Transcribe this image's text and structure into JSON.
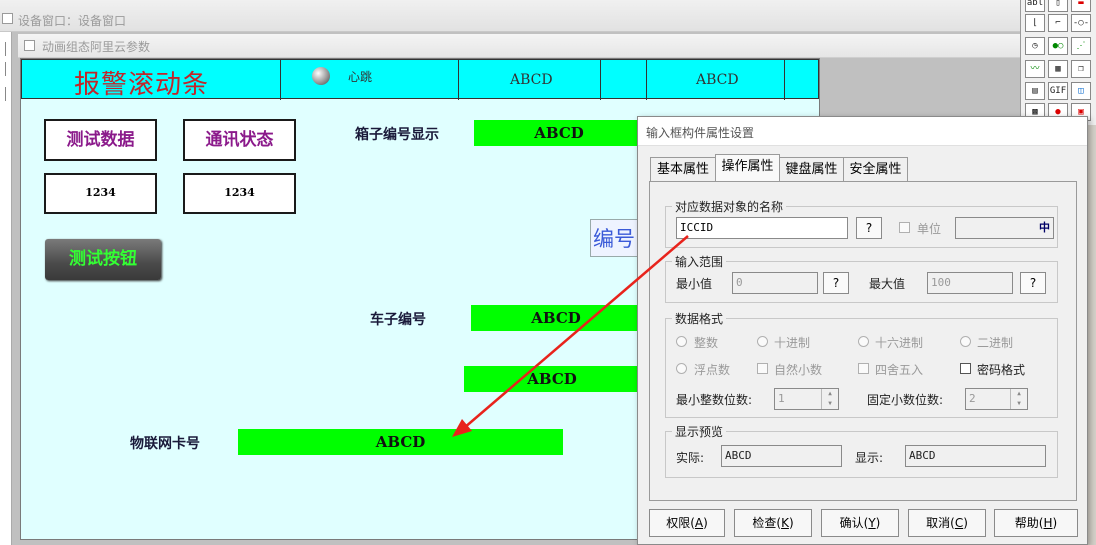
{
  "outer_window": {
    "title": "设备窗口：设备窗口"
  },
  "inner_window": {
    "title": "动画组态阿里云参数"
  },
  "header_bar": {
    "alarm_scroll_text": "报警滚动条",
    "heartbeat_label": "心跳",
    "cell1": "ABCD",
    "cell2": "ABCD"
  },
  "canvas": {
    "test_data_label": "测试数据",
    "comm_status_label": "通讯状态",
    "test_data_value": "1234",
    "comm_status_value": "1234",
    "test_button_label": "测试按钮",
    "box_id_label": "箱子编号显示",
    "box_id_value": "ABCD",
    "bianhao_text": "编号",
    "car_id_label": "车子编号",
    "car_id_value": "ABCD",
    "extra_value": "ABCD",
    "iot_card_label": "物联网卡号",
    "iot_card_value": "ABCD"
  },
  "toolbox": {
    "icons": [
      "text-tool-icon",
      "input-box-icon",
      "flag-icon",
      "line-icon",
      "step-line-icon",
      "connector-icon",
      "clock-icon",
      "network-icon",
      "trend-icon",
      "chart-icon",
      "grid-icon",
      "layers-icon",
      "image-icon",
      "gif-icon",
      "picture-icon",
      "component-icon",
      "record-icon",
      "doc-icon"
    ],
    "text_tool": "abl",
    "gif_tool": "GIF"
  },
  "dialog": {
    "title": "输入框构件属性设置",
    "tabs": [
      "基本属性",
      "操作属性",
      "键盘属性",
      "安全属性"
    ],
    "active_tab": "操作属性",
    "data_object_group": "对应数据对象的名称",
    "data_object_value": "ICCID",
    "question_mark": "?",
    "unit_label": "单位",
    "unit_glyph": "中",
    "input_range_group": "输入范围",
    "min_label": "最小值",
    "min_value": "0",
    "max_label": "最大值",
    "max_value": "100",
    "data_format_group": "数据格式",
    "formats_row1": [
      "整数",
      "十进制",
      "十六进制",
      "二进制"
    ],
    "formats_row2": [
      "浮点数",
      "自然小数",
      "四舍五入",
      "密码格式"
    ],
    "min_int_digits_label": "最小整数位数:",
    "min_int_digits_value": "1",
    "fixed_decimal_label": "固定小数位数:",
    "fixed_decimal_value": "2",
    "preview_group": "显示预览",
    "actual_label": "实际:",
    "actual_value": "ABCD",
    "display_label": "显示:",
    "display_value": "ABCD",
    "buttons": [
      {
        "label": "权限",
        "key": "A"
      },
      {
        "label": "检查",
        "key": "K"
      },
      {
        "label": "确认",
        "key": "Y"
      },
      {
        "label": "取消",
        "key": "C"
      },
      {
        "label": "帮助",
        "key": "H"
      }
    ]
  },
  "colors": {
    "header_cyan": "#00ffff",
    "canvas_bg": "#e0ffff",
    "bar_green": "#00ff00",
    "alarm_red": "#c0262a",
    "label_purple": "#8b1a8b",
    "arrow_red": "#e8231c"
  }
}
